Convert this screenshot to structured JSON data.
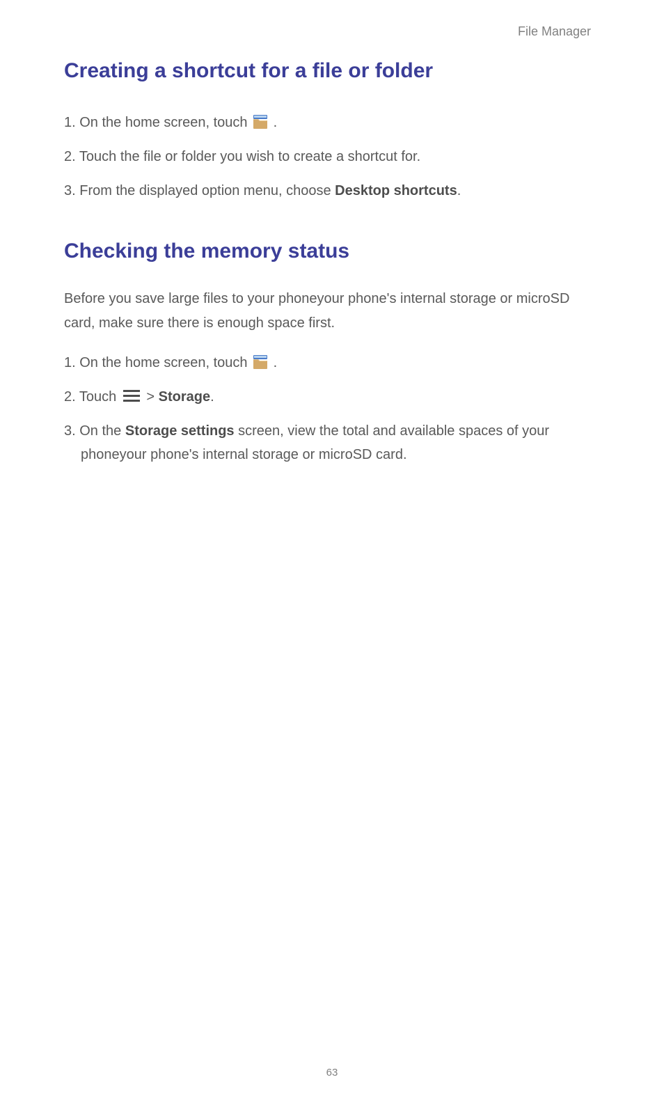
{
  "header": {
    "label": "File Manager"
  },
  "section1": {
    "heading": "Creating a shortcut for a file or folder",
    "steps": {
      "s1a": "On the home screen, touch ",
      "s1b": " .",
      "s2": "Touch the file or folder you wish to create a shortcut for.",
      "s3a": "From the displayed option menu, choose ",
      "s3b": "Desktop shortcuts",
      "s3c": "."
    }
  },
  "section2": {
    "heading": "Checking the memory status",
    "intro": "Before you save large files to your phoneyour phone's internal storage or microSD card, make sure there is enough space first.",
    "steps": {
      "s1a": "On the home screen, touch ",
      "s1b": " .",
      "s2a": "Touch ",
      "s2b": " > ",
      "s2c": "Storage",
      "s2d": ".",
      "s3a": "On the ",
      "s3b": "Storage settings",
      "s3c": " screen, view the total and available spaces of your phoneyour phone's internal storage or microSD card."
    }
  },
  "pageNumber": "63"
}
